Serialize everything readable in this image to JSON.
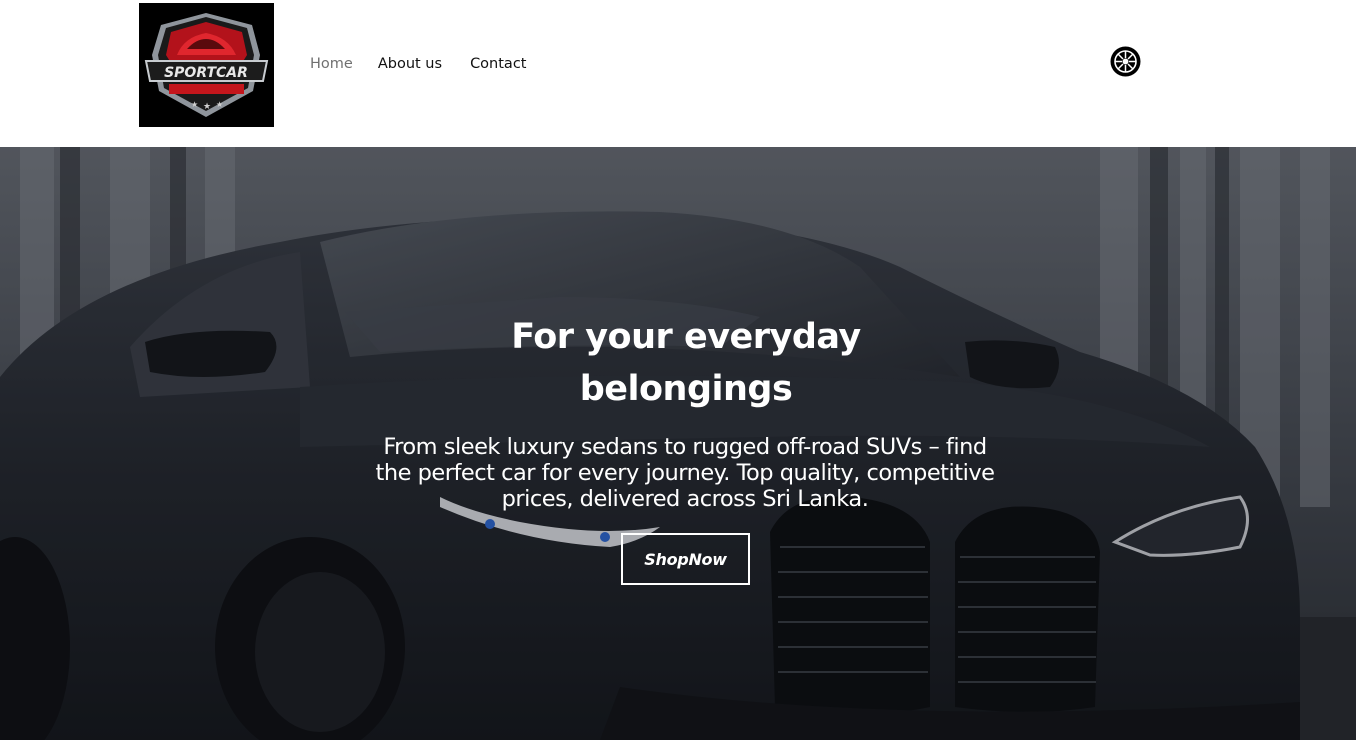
{
  "brand": {
    "logo_text": "SPORTCAR",
    "colors": {
      "logo_red": "#c4161c",
      "logo_silver": "#bfc3c8"
    }
  },
  "nav": {
    "items": [
      {
        "label": "Home",
        "active": true
      },
      {
        "label": "About us",
        "active": false
      },
      {
        "label": "Contact",
        "active": false
      }
    ]
  },
  "header_actions": {
    "icon": "wheel-icon"
  },
  "hero": {
    "title": "For your everyday belongings",
    "subtitle": "From sleek luxury sedans to rugged off-road SUVs – find the perfect car for every journey. Top quality, competitive prices, delivered across Sri Lanka.",
    "cta_label": "ShopNow",
    "background": "dark-sports-car-photo"
  }
}
